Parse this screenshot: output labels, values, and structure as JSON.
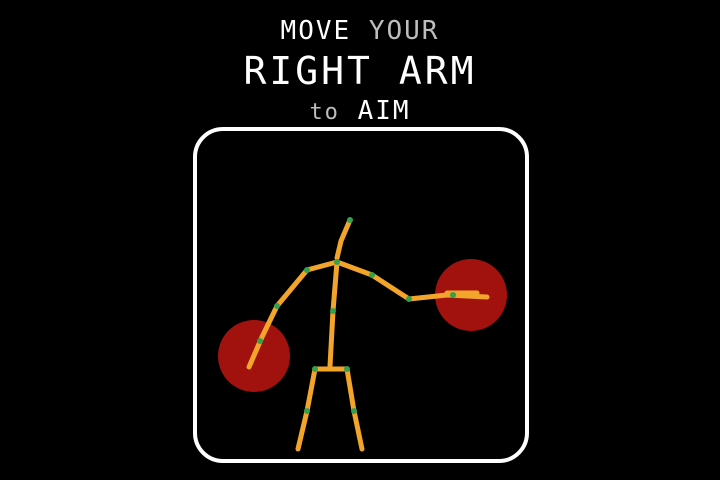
{
  "instructions": {
    "line1": {
      "word1": "MOVE",
      "word2": "YOUR"
    },
    "line2": "RIGHT ARM",
    "line3": {
      "word1": "to",
      "word2": "AIM"
    }
  },
  "colors": {
    "background": "#000000",
    "text": "#ffffff",
    "text_dim": "#bdbdbd",
    "frame_border": "#ffffff",
    "skeleton_bone": "#f2a52a",
    "skeleton_joint": "#35a04a",
    "target_fill": "#b3140f"
  },
  "skeleton": {
    "icon": "stick-figure-icon",
    "targets": [
      "target-left-icon",
      "target-right-icon"
    ]
  }
}
